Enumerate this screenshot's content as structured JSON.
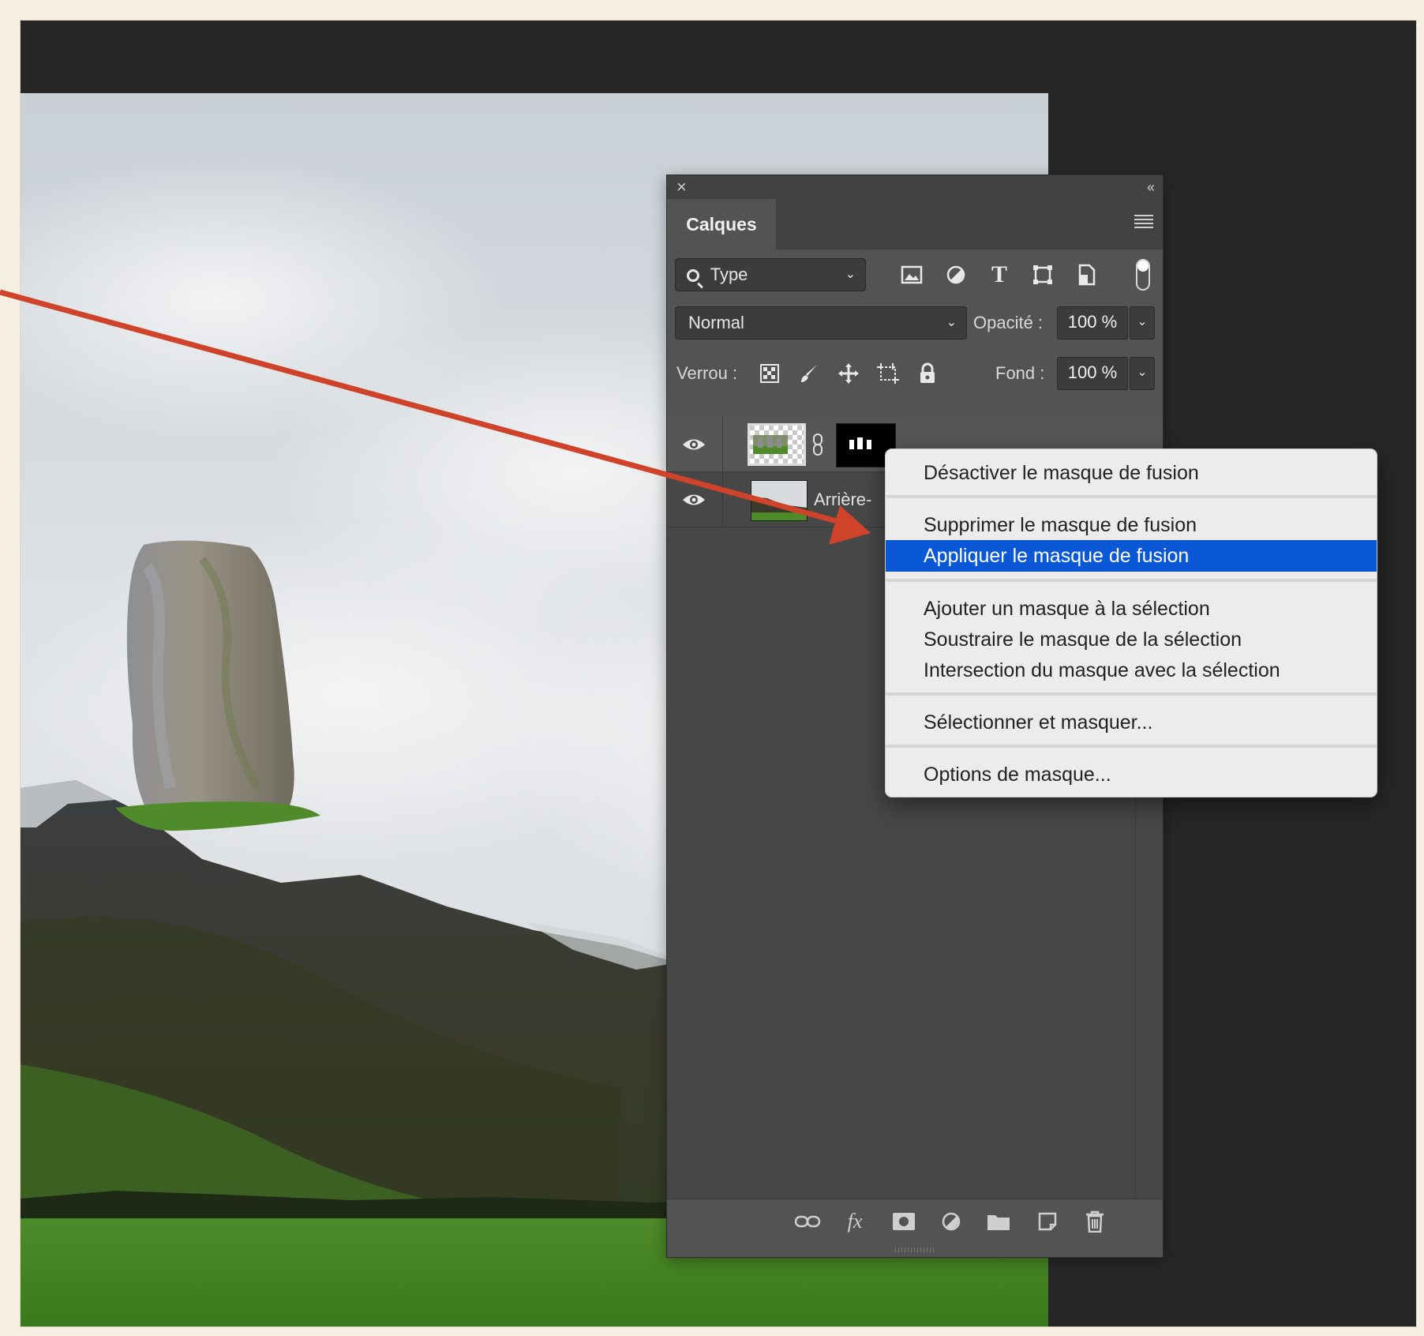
{
  "panel": {
    "title": "Calques",
    "filter": {
      "label": "Type"
    },
    "blend_mode": "Normal",
    "opacity_label": "Opacité :",
    "opacity_value": "100 %",
    "lock_label": "Verrou :",
    "fill_label": "Fond :",
    "fill_value": "100 %",
    "layers": [
      {
        "name": "",
        "has_mask": true,
        "visible": true
      },
      {
        "name": "Arrière-",
        "has_mask": false,
        "visible": true
      }
    ]
  },
  "context_menu": {
    "items": [
      {
        "label": "Désactiver le masque de fusion",
        "highlighted": false
      },
      {
        "label": "Supprimer le masque de fusion",
        "highlighted": false
      },
      {
        "label": "Appliquer le masque de fusion",
        "highlighted": true
      },
      {
        "label": "Ajouter un masque à la sélection",
        "highlighted": false
      },
      {
        "label": "Soustraire le masque de la sélection",
        "highlighted": false
      },
      {
        "label": "Intersection du masque avec la sélection",
        "highlighted": false
      },
      {
        "label": "Sélectionner et masquer...",
        "highlighted": false
      },
      {
        "label": "Options de masque...",
        "highlighted": false
      }
    ]
  },
  "colors": {
    "highlight": "#0a58d6",
    "annotation_arrow": "#d0432b",
    "panel_bg": "#535353"
  }
}
